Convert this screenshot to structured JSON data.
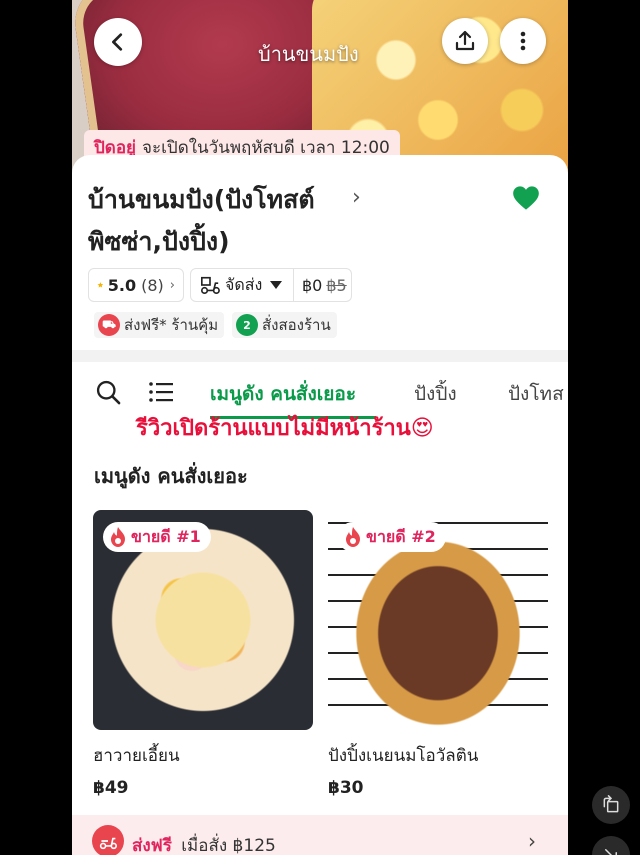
{
  "hero": {
    "title": "บ้านขนมปัง",
    "back_icon": "chevron-left-icon",
    "share_icon": "share-icon",
    "more_icon": "more-vertical-icon"
  },
  "status": {
    "closed_label": "ปิดอยู่",
    "opening_text": "จะเปิดในวันพฤหัสบดี เวลา 12:00"
  },
  "shop": {
    "name": "บ้านขนมปัง(ปังโทสต์ พิซซ่า,ปังปิ้ง)",
    "favorite_color": "#12a150"
  },
  "chips": {
    "rating": "5.0",
    "review_count": "(8)",
    "delivery_label": "จัดส่ง",
    "fee": "฿0",
    "fee_original": "฿5"
  },
  "promos": {
    "free_delivery": "ส่งฟรี* ร้านคุ้ม",
    "pickup": "สั่งสองร้าน"
  },
  "tabs": [
    {
      "label": "เมนูดัง คนสั่งเยอะ",
      "active": true
    },
    {
      "label": "ปังปิ้ง",
      "active": false
    },
    {
      "label": "ปังโทส",
      "active": false
    }
  ],
  "overlay_caption": "รีวิวเปิดร้านแบบไม่มีหน้าร้าน😍",
  "section": {
    "title": "เมนูดัง คนสั่งเยอะ"
  },
  "products": [
    {
      "badge": "ขายดี #1",
      "name": "ฮาวายเอี้ยน",
      "price": "฿49"
    },
    {
      "badge": "ขายดี #2",
      "name": "ปังปิ้งเนยนมโอวัลติน",
      "price": "฿30"
    }
  ],
  "free_banner": {
    "highlight": "ส่งฟรี",
    "text": "เมื่อสั่ง ฿125"
  },
  "colors": {
    "accent_green": "#0a9a4a",
    "closed_red": "#e0245e",
    "caption_red": "#e8103a"
  }
}
